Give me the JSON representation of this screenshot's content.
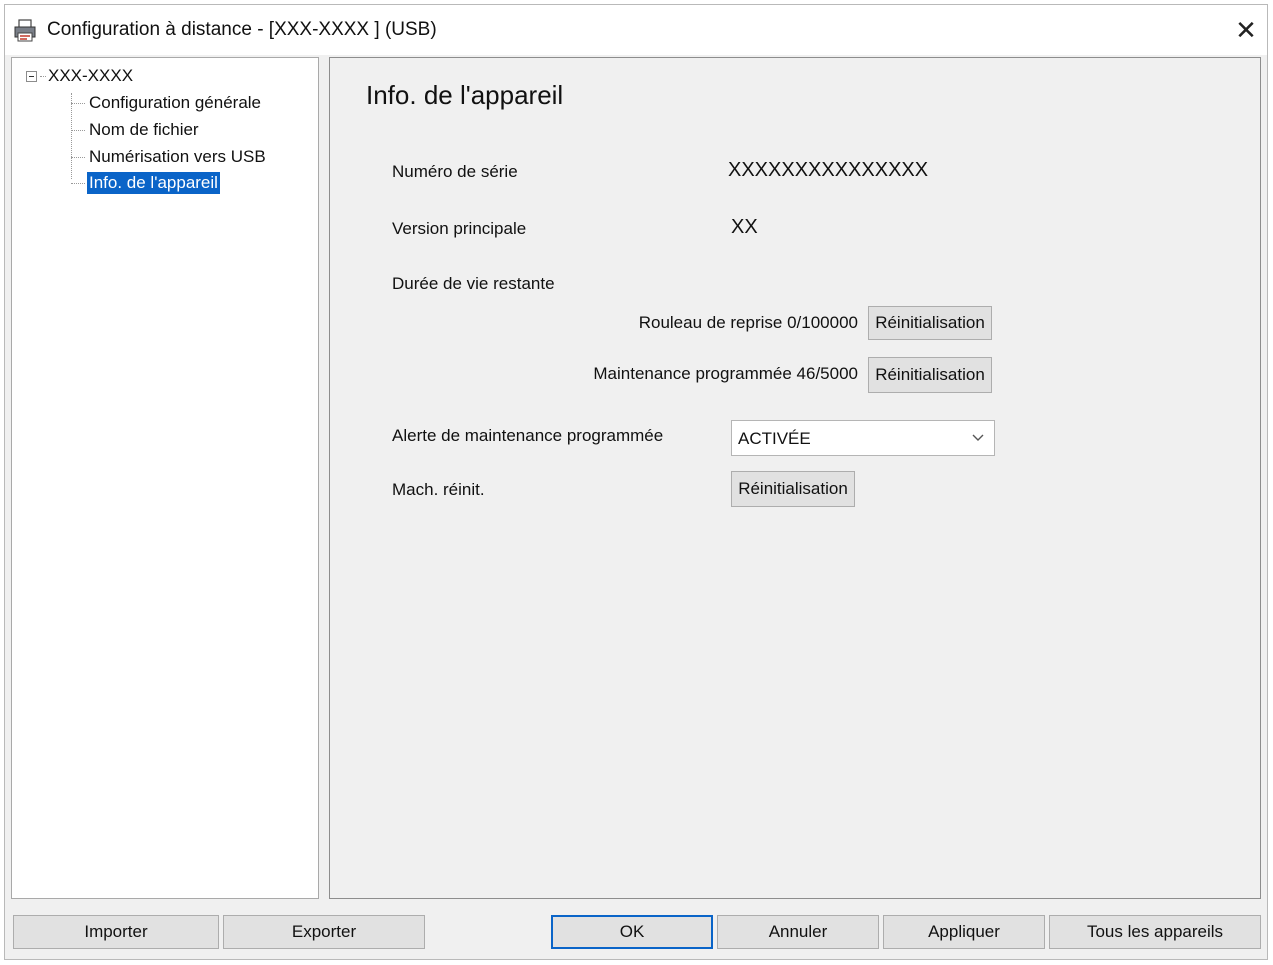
{
  "window": {
    "title": "Configuration à distance - [XXX-XXXX ] (USB)",
    "icons": {
      "app": "printer-icon",
      "close": "close-icon"
    },
    "close_glyph": "✕"
  },
  "tree": {
    "root": "XXX-XXXX",
    "items": [
      {
        "label": "Configuration générale",
        "selected": false
      },
      {
        "label": "Nom de fichier",
        "selected": false
      },
      {
        "label": "Numérisation vers USB",
        "selected": false
      },
      {
        "label": "Info. de l'appareil",
        "selected": true
      }
    ]
  },
  "content": {
    "title": "Info. de l'appareil",
    "serial_label": "Numéro de série",
    "serial_value": "XXXXXXXXXXXXXXX",
    "version_label": "Version principale",
    "version_value": "XX",
    "lifetime_label": "Durée de vie restante",
    "pickup_roller_label": "Rouleau de reprise 0/100000",
    "pickup_reset_label": "Réinitialisation",
    "maintenance_label": "Maintenance programmée 46/5000",
    "maintenance_reset_label": "Réinitialisation",
    "alert_label": "Alerte de maintenance programmée",
    "alert_value": "ACTIVÉE",
    "machine_reset_label": "Mach. réinit.",
    "machine_reset_button": "Réinitialisation"
  },
  "buttons": {
    "import": "Importer",
    "export": "Exporter",
    "ok": "OK",
    "cancel": "Annuler",
    "apply": "Appliquer",
    "all_devices": "Tous les appareils"
  },
  "colors": {
    "selection": "#0a64c8",
    "dialog_bg": "#f0f0f0",
    "button_bg": "#e1e1e1"
  }
}
